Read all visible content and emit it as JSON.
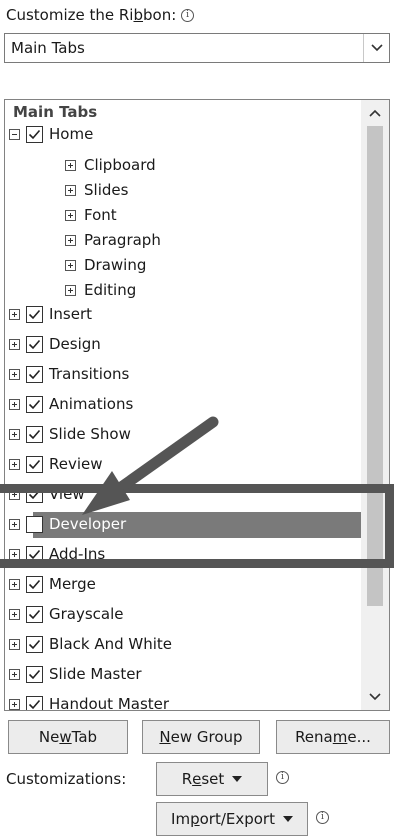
{
  "customize": {
    "label_pre": "Customize the Ri",
    "label_ul": "b",
    "label_post": "bon:",
    "info_glyph": "i",
    "dropdown_value": "Main Tabs"
  },
  "list": {
    "header": "Main Tabs",
    "items": [
      {
        "label": "Home",
        "level": 0,
        "expander": "minus",
        "checkbox": true
      },
      {
        "label": "Clipboard",
        "level": 1,
        "expander": "plus",
        "checkbox": null
      },
      {
        "label": "Slides",
        "level": 1,
        "expander": "plus",
        "checkbox": null
      },
      {
        "label": "Font",
        "level": 1,
        "expander": "plus",
        "checkbox": null
      },
      {
        "label": "Paragraph",
        "level": 1,
        "expander": "plus",
        "checkbox": null
      },
      {
        "label": "Drawing",
        "level": 1,
        "expander": "plus",
        "checkbox": null
      },
      {
        "label": "Editing",
        "level": 1,
        "expander": "plus",
        "checkbox": null
      },
      {
        "label": "Insert",
        "level": 0,
        "expander": "plus",
        "checkbox": true
      },
      {
        "label": "Design",
        "level": 0,
        "expander": "plus",
        "checkbox": true
      },
      {
        "label": "Transitions",
        "level": 0,
        "expander": "plus",
        "checkbox": true
      },
      {
        "label": "Animations",
        "level": 0,
        "expander": "plus",
        "checkbox": true
      },
      {
        "label": "Slide Show",
        "level": 0,
        "expander": "plus",
        "checkbox": true
      },
      {
        "label": "Review",
        "level": 0,
        "expander": "plus",
        "checkbox": true
      },
      {
        "label": "View",
        "level": 0,
        "expander": "plus",
        "checkbox": true
      },
      {
        "label": "Developer",
        "level": 0,
        "expander": "plus",
        "checkbox": false,
        "selected": true
      },
      {
        "label": "Add-Ins",
        "level": 0,
        "expander": "plus",
        "checkbox": true
      },
      {
        "label": "Merge",
        "level": 0,
        "expander": "plus",
        "checkbox": true
      },
      {
        "label": "Grayscale",
        "level": 0,
        "expander": "plus",
        "checkbox": true
      },
      {
        "label": "Black And White",
        "level": 0,
        "expander": "plus",
        "checkbox": true
      },
      {
        "label": "Slide Master",
        "level": 0,
        "expander": "plus",
        "checkbox": true
      },
      {
        "label": "Handout Master",
        "level": 0,
        "expander": "plus",
        "checkbox": true
      }
    ]
  },
  "buttons": {
    "new_tab_pre": "Ne",
    "new_tab_ul": "w",
    "new_tab_post": " Tab",
    "new_group_pre": "",
    "new_group_ul": "N",
    "new_group_post": "ew Group",
    "rename_pre": "Rena",
    "rename_ul": "m",
    "rename_post": "e...",
    "customizations_label": "Customizations:",
    "reset_pre": "R",
    "reset_ul": "e",
    "reset_post": "set",
    "import_pre": "Im",
    "import_ul": "p",
    "import_post": "ort/Export"
  },
  "colors": {
    "selected_row": "#7a7a7a",
    "highlight_box": "#555555"
  }
}
